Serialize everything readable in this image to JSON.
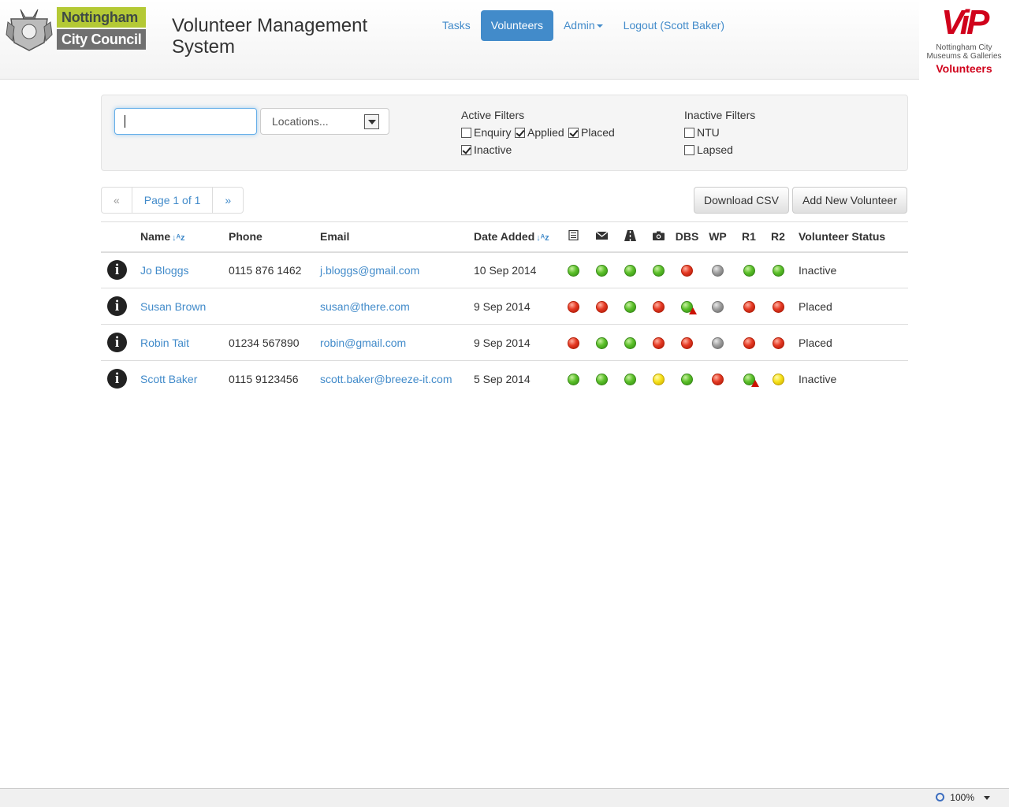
{
  "header": {
    "ncc_line1": "Nottingham",
    "ncc_line2": "City Council",
    "app_title": "Volunteer Management System",
    "nav": [
      "Tasks",
      "Volunteers",
      "Admin",
      "Logout (Scott Baker)"
    ],
    "vip_mark": "ViP",
    "vip_sub": "Nottingham City Museums & Galleries",
    "vip_vol": "Volunteers",
    "accent_color": "#428bca",
    "brand_red": "#d0021b"
  },
  "filters": {
    "search_value": "",
    "location_select": "Locations...",
    "active_title": "Active Filters",
    "active": [
      {
        "label": "Enquiry",
        "checked": false
      },
      {
        "label": "Applied",
        "checked": true
      },
      {
        "label": "Placed",
        "checked": true
      },
      {
        "label": "Inactive",
        "checked": true
      }
    ],
    "inactive_title": "Inactive Filters",
    "inactive": [
      {
        "label": "NTU",
        "checked": false
      },
      {
        "label": "Lapsed",
        "checked": false
      }
    ]
  },
  "pager": {
    "prev": "«",
    "page": "Page 1 of 1",
    "next": "»"
  },
  "buttons": {
    "download": "Download CSV",
    "add": "Add New Volunteer"
  },
  "table": {
    "headers": {
      "name": "Name",
      "phone": "Phone",
      "email": "Email",
      "date": "Date Added",
      "icon1": "list-icon",
      "icon2": "envelope-icon",
      "icon3": "road-icon",
      "icon4": "camera-icon",
      "dbs": "DBS",
      "wp": "WP",
      "r1": "R1",
      "r2": "R2",
      "status": "Volunteer Status"
    },
    "rows": [
      {
        "name": "Jo Bloggs",
        "phone": "0115 876 1462",
        "email": "j.bloggs@gmail.com",
        "date": "10 Sep 2014",
        "status": "Inactive",
        "dots": [
          "green",
          "green",
          "green",
          "green",
          "red",
          "grey",
          "green",
          "green"
        ],
        "warn": []
      },
      {
        "name": "Susan Brown",
        "phone": "",
        "email": "susan@there.com",
        "date": "9 Sep 2014",
        "status": "Placed",
        "dots": [
          "red",
          "red",
          "green",
          "red",
          "green",
          "grey",
          "red",
          "red"
        ],
        "warn": [
          4
        ]
      },
      {
        "name": "Robin Tait",
        "phone": "01234 567890",
        "email": "robin@gmail.com",
        "date": "9 Sep 2014",
        "status": "Placed",
        "dots": [
          "red",
          "green",
          "green",
          "red",
          "red",
          "grey",
          "red",
          "red"
        ],
        "warn": []
      },
      {
        "name": "Scott Baker",
        "phone": "0115 9123456",
        "email": "scott.baker@breeze-it.com",
        "date": "5 Sep 2014",
        "status": "Inactive",
        "dots": [
          "green",
          "green",
          "green",
          "yellow",
          "green",
          "red",
          "green",
          "yellow"
        ],
        "warn": [
          6
        ]
      }
    ]
  },
  "statusbar": {
    "zoom": "100%"
  }
}
